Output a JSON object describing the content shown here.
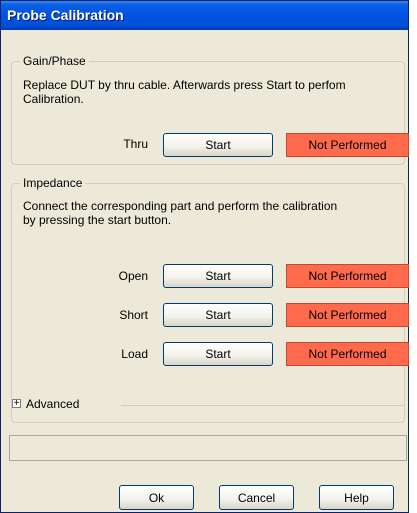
{
  "window": {
    "title": "Probe Calibration"
  },
  "gain_phase": {
    "legend": "Gain/Phase",
    "description_line1": "Replace DUT by thru cable. Afterwards press Start to perfom",
    "description_line2": "Calibration.",
    "rows": [
      {
        "label": "Thru",
        "button": "Start",
        "status": "Not Performed"
      }
    ]
  },
  "impedance": {
    "legend": "Impedance",
    "description_line1": "Connect the corresponding part and perform the calibration",
    "description_line2": "by pressing the start button.",
    "rows": [
      {
        "label": "Open",
        "button": "Start",
        "status": "Not Performed"
      },
      {
        "label": "Short",
        "button": "Start",
        "status": "Not Performed"
      },
      {
        "label": "Load",
        "button": "Start",
        "status": "Not Performed"
      }
    ]
  },
  "advanced": {
    "label": "Advanced",
    "expander_symbol": "+"
  },
  "footer": {
    "ok": "Ok",
    "cancel": "Cancel",
    "help": "Help"
  },
  "colors": {
    "status_not_performed": "#ff6a4d",
    "titlebar": "#0053e3"
  }
}
